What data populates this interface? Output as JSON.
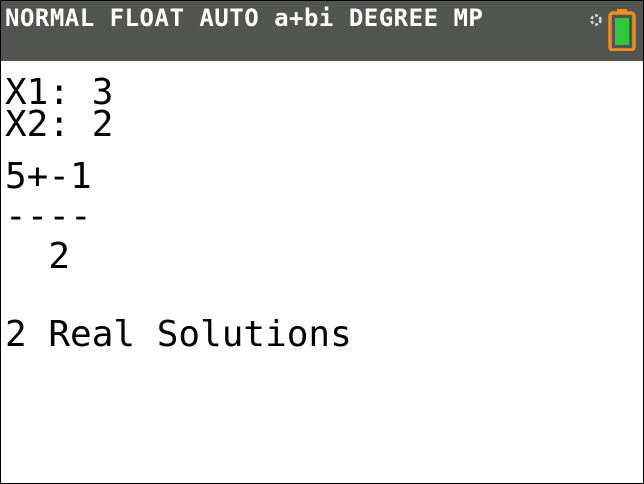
{
  "status_bar": {
    "mode_text": "NORMAL FLOAT AUTO a+bi DEGREE MP",
    "background_color": "#525551",
    "text_color": "#ffffff",
    "busy_icon": "busy-indicator-icon",
    "battery_icon": "battery-icon",
    "battery_color": "#f08c1e",
    "battery_level_color": "#2dc83c"
  },
  "home_screen": {
    "lines": [
      "X1: 3",
      "X2: 2",
      "5+-1",
      "----",
      "  2",
      "2 Real Solutions"
    ]
  }
}
